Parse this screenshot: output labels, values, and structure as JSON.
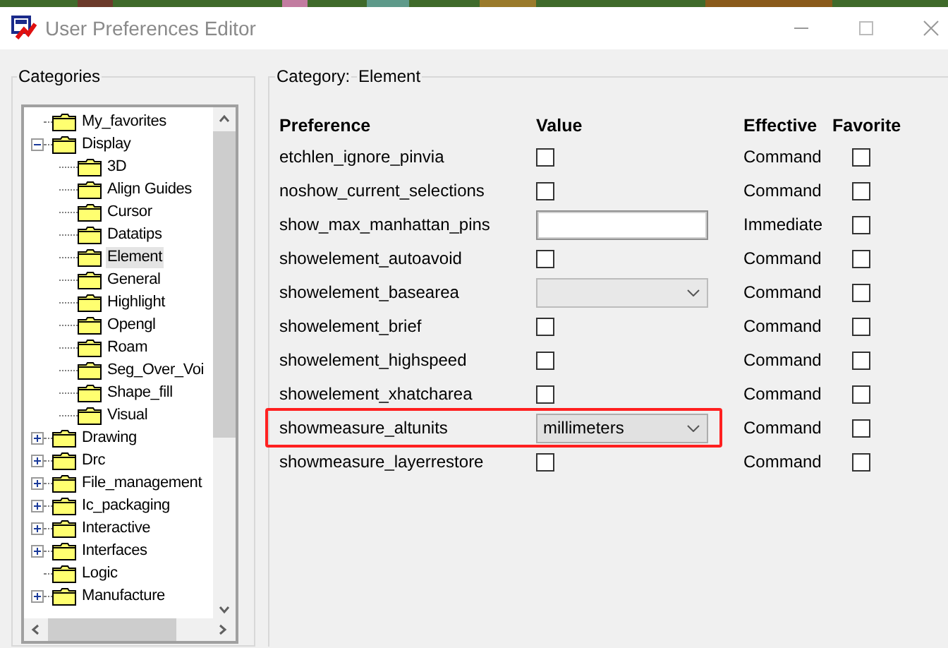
{
  "window": {
    "title": "User Preferences Editor"
  },
  "categories": {
    "title": "Categories",
    "tree": [
      {
        "label": "My_favorites",
        "selected": false
      },
      {
        "label": "Display",
        "expanded": true,
        "selected": false,
        "children": [
          {
            "label": "3D",
            "selected": false
          },
          {
            "label": "Align Guides",
            "selected": false
          },
          {
            "label": "Cursor",
            "selected": false
          },
          {
            "label": "Datatips",
            "selected": false
          },
          {
            "label": "Element",
            "selected": true
          },
          {
            "label": "General",
            "selected": false
          },
          {
            "label": "Highlight",
            "selected": false
          },
          {
            "label": "Opengl",
            "selected": false
          },
          {
            "label": "Roam",
            "selected": false
          },
          {
            "label": "Seg_Over_Voi",
            "selected": false
          },
          {
            "label": "Shape_fill",
            "selected": false
          },
          {
            "label": "Visual",
            "selected": false
          }
        ]
      },
      {
        "label": "Drawing",
        "expanded": false,
        "selected": false
      },
      {
        "label": "Drc",
        "expanded": false,
        "selected": false
      },
      {
        "label": "File_management",
        "expanded": false,
        "selected": false
      },
      {
        "label": "Ic_packaging",
        "expanded": false,
        "selected": false
      },
      {
        "label": "Interactive",
        "expanded": false,
        "selected": false
      },
      {
        "label": "Interfaces",
        "expanded": false,
        "selected": false
      },
      {
        "label": "Logic",
        "selected": false
      },
      {
        "label": "Manufacture",
        "expanded": false,
        "selected": false
      }
    ]
  },
  "details": {
    "category_label": "Category:",
    "category": "Element",
    "columns": [
      "Preference",
      "Value",
      "Effective",
      "Favorite"
    ],
    "rows": [
      {
        "name": "etchlen_ignore_pinvia",
        "kind": "checkbox",
        "checked": false,
        "effective": "Command",
        "favorite": false,
        "highlighted": false
      },
      {
        "name": "noshow_current_selections",
        "kind": "checkbox",
        "checked": false,
        "effective": "Command",
        "favorite": false,
        "highlighted": false
      },
      {
        "name": "show_max_manhattan_pins",
        "kind": "text",
        "effective": "Immediate",
        "favorite": false,
        "highlighted": false
      },
      {
        "name": "showelement_autoavoid",
        "kind": "checkbox",
        "checked": false,
        "effective": "Command",
        "favorite": false,
        "highlighted": false
      },
      {
        "name": "showelement_basearea",
        "kind": "dropdown",
        "disabled": true,
        "effective": "Command",
        "favorite": false,
        "highlighted": false
      },
      {
        "name": "showelement_brief",
        "kind": "checkbox",
        "checked": false,
        "effective": "Command",
        "favorite": false,
        "highlighted": false
      },
      {
        "name": "showelement_highspeed",
        "kind": "checkbox",
        "checked": false,
        "effective": "Command",
        "favorite": false,
        "highlighted": false
      },
      {
        "name": "showelement_xhatcharea",
        "kind": "checkbox",
        "checked": false,
        "effective": "Command",
        "favorite": false,
        "highlighted": false
      },
      {
        "name": "showmeasure_altunits",
        "kind": "dropdown",
        "value": "millimeters",
        "disabled": false,
        "effective": "Command",
        "favorite": false,
        "highlighted": true
      },
      {
        "name": "showmeasure_layerrestore",
        "kind": "checkbox",
        "checked": false,
        "effective": "Command",
        "favorite": false,
        "highlighted": false
      }
    ]
  }
}
